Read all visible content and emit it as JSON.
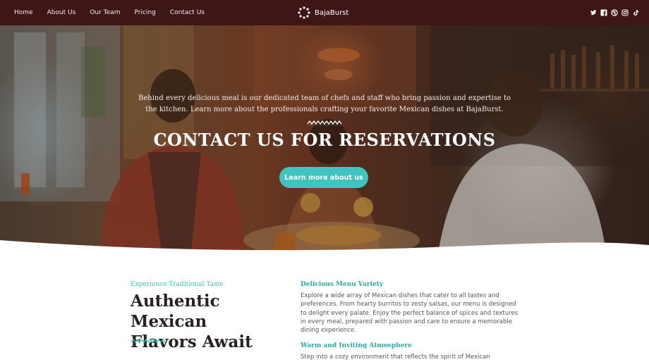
{
  "nav": {
    "links": [
      "Home",
      "About Us",
      "Our Team",
      "Pricing",
      "Contact Us"
    ],
    "brand": "BajaBurst",
    "social_icons": [
      "twitter-icon",
      "facebook-icon",
      "dribbble-icon",
      "instagram-icon",
      "tiktok-icon"
    ]
  },
  "hero": {
    "intro": "Behind every delicious meal is our dedicated team of chefs and staff who bring passion and expertise to the kitchen. Learn more about the professionals crafting your favorite Mexican dishes at BajaBurst.",
    "title": "CONTACT US FOR RESERVATIONS",
    "cta": "Learn more about us"
  },
  "section": {
    "eyebrow": "Experience Traditional Taste",
    "title_line1": "Authentic Mexican",
    "title_line2": "Flavors Await",
    "features": [
      {
        "title": "Delicious Menu Variety",
        "text": "Explore a wide array of Mexican dishes that cater to all tastes and preferences. From hearty burritos to zesty salsas, our menu is designed to delight every palate. Enjoy the perfect balance of spices and textures in every meal, prepared with passion and care to ensure a memorable dining experience."
      },
      {
        "title": "Warm and Inviting Atmosphere",
        "text": "Step into a cozy environment that reflects the spirit of Mexican hospitality. Our"
      }
    ]
  },
  "colors": {
    "nav_bg": "#3e1618",
    "accent": "#3fc4c0",
    "heading": "#2a2222"
  }
}
